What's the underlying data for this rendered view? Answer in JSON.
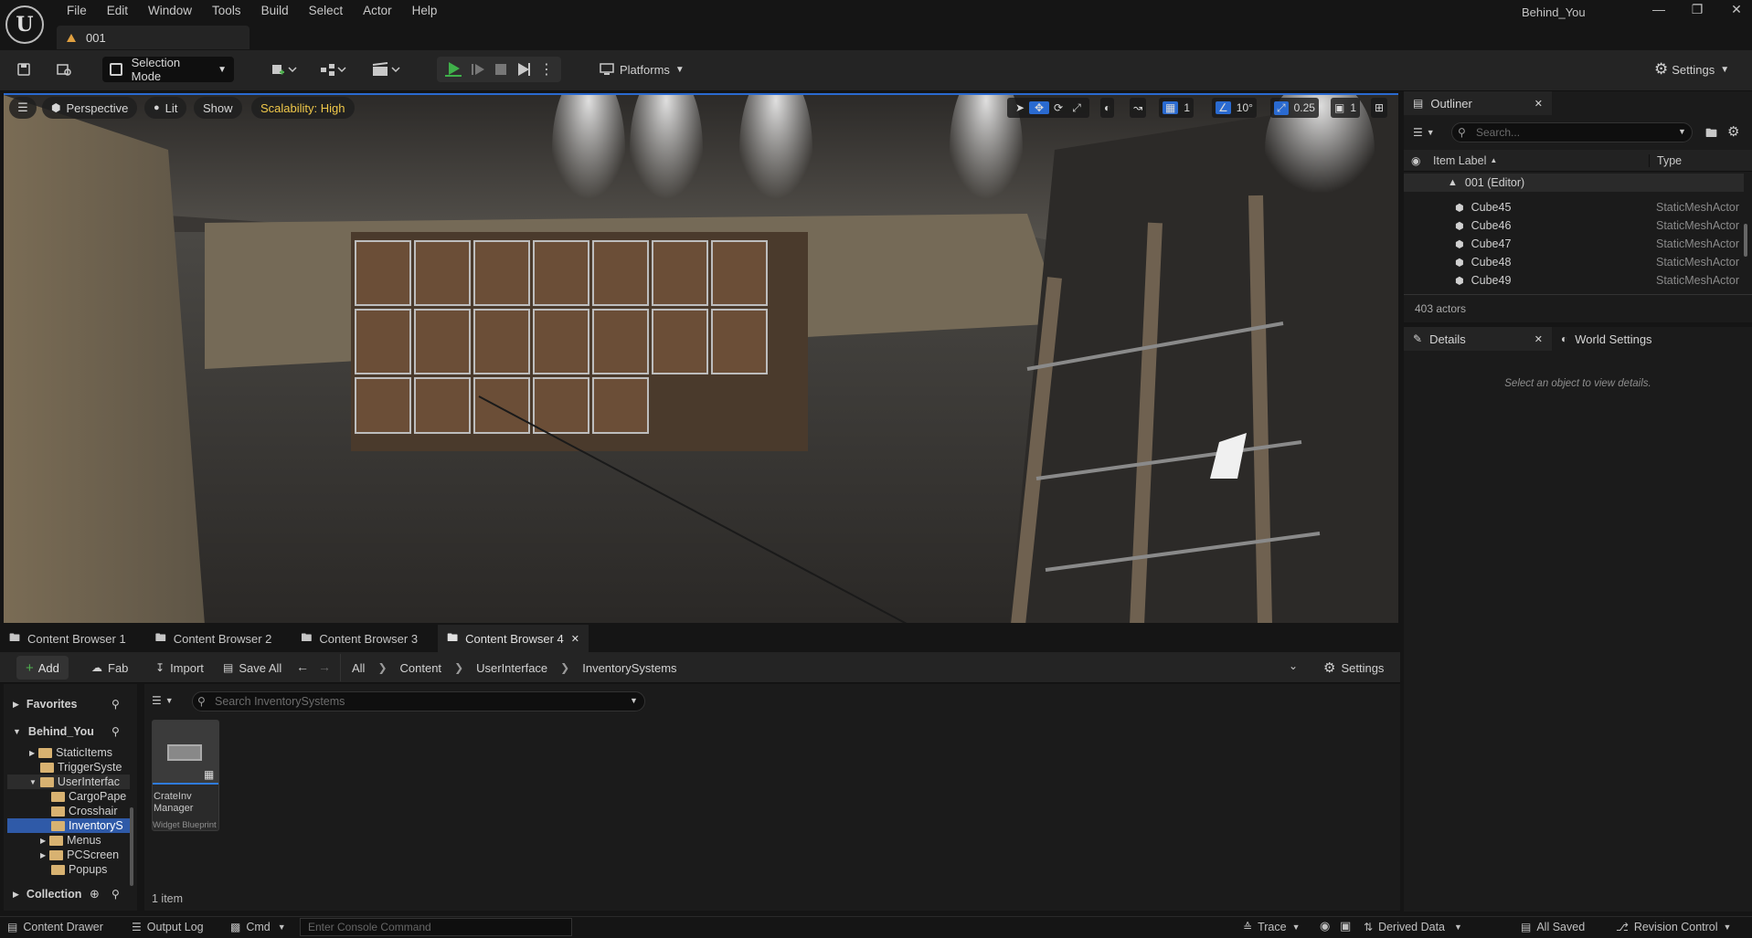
{
  "menu": [
    "File",
    "Edit",
    "Window",
    "Tools",
    "Build",
    "Select",
    "Actor",
    "Help"
  ],
  "window": {
    "project": "Behind_You",
    "level_tab": "001"
  },
  "toolbar": {
    "selection_mode": "Selection Mode",
    "platforms": "Platforms",
    "settings": "Settings"
  },
  "viewport": {
    "perspective": "Perspective",
    "lit": "Lit",
    "show": "Show",
    "scalability": "Scalability: High",
    "grid_value": "1",
    "angle_value": "10°",
    "scale_value": "0.25",
    "camera_speed": "1"
  },
  "outliner": {
    "title": "Outliner",
    "search_placeholder": "Search...",
    "col_label": "Item Label",
    "col_type": "Type",
    "root": "001 (Editor)",
    "rows": [
      {
        "label": "Cube45",
        "type": "StaticMeshActor"
      },
      {
        "label": "Cube46",
        "type": "StaticMeshActor"
      },
      {
        "label": "Cube47",
        "type": "StaticMeshActor"
      },
      {
        "label": "Cube48",
        "type": "StaticMeshActor"
      },
      {
        "label": "Cube49",
        "type": "StaticMeshActor"
      }
    ],
    "actor_count": "403 actors"
  },
  "details": {
    "tab": "Details",
    "world_tab": "World Settings",
    "empty": "Select an object to view details."
  },
  "content_browser": {
    "tabs": [
      "Content Browser 1",
      "Content Browser 2",
      "Content Browser 3",
      "Content Browser 4"
    ],
    "add": "Add",
    "fab": "Fab",
    "import": "Import",
    "save_all": "Save All",
    "breadcrumb": [
      "All",
      "Content",
      "UserInterface",
      "InventorySystems"
    ],
    "settings": "Settings",
    "favorites": "Favorites",
    "project": "Behind_You",
    "search_placeholder": "Search InventorySystems",
    "tree": [
      "StaticItems",
      "TriggerSyste",
      "UserInterfac",
      "CargoPape",
      "Crosshair",
      "InventoryS",
      "Menus",
      "PCScreen",
      "Popups"
    ],
    "collection": "Collection",
    "asset": {
      "name_line1": "CrateInv",
      "name_line2": "Manager",
      "type": "Widget Blueprint"
    },
    "item_count": "1 item"
  },
  "status": {
    "drawer": "Content Drawer",
    "output_log": "Output Log",
    "cmd": "Cmd",
    "console_placeholder": "Enter Console Command",
    "trace": "Trace",
    "derived": "Derived Data",
    "saved": "All Saved",
    "revision": "Revision Control"
  }
}
